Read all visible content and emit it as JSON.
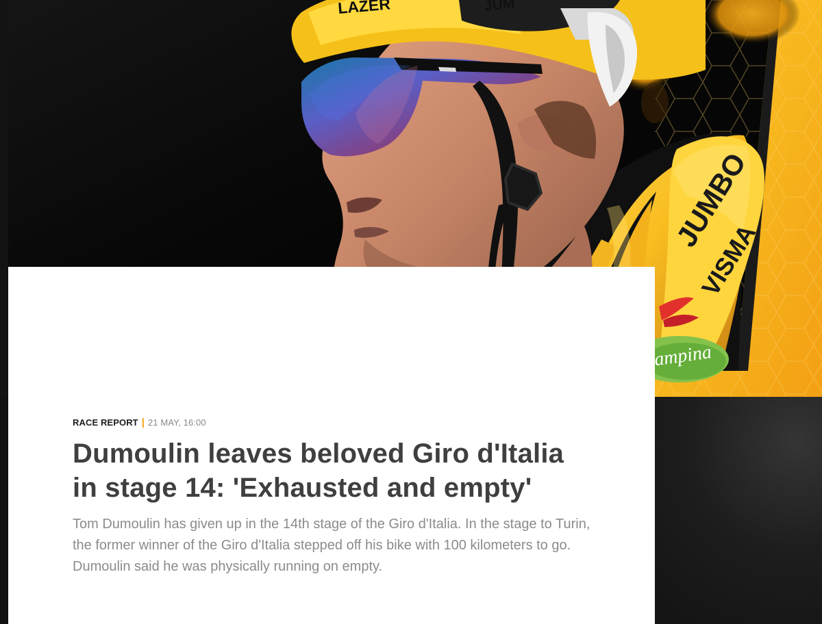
{
  "hero": {
    "image_alt": "Cyclist in a yellow Jumbo-Visma helmet and jersey",
    "helmet_brand": "LAZER",
    "helmet_sponsor": "JUM",
    "jersey_brand_line1": "JUMBO",
    "jersey_brand_line2": "VISMA",
    "sleeve_text": "VISMA",
    "badge_text": "Campina",
    "colors": {
      "brand_yellow": "#f7b51d",
      "dark_background": "#090909",
      "black_panel": "#111111",
      "accent_orange": "#f5a312"
    }
  },
  "article": {
    "category": "RACE REPORT",
    "separator": "|",
    "date": "21 MAY, 16:00",
    "headline": "Dumoulin leaves beloved Giro d'Italia in stage 14: 'Exhausted and empty'",
    "summary": "Tom Dumoulin has given up in the 14th stage of the Giro d'Italia. In the stage to Turin, the former winner of the Giro d'Italia stepped off his bike with 100 kilometers to go. Dumoulin said he was physically running on empty."
  }
}
